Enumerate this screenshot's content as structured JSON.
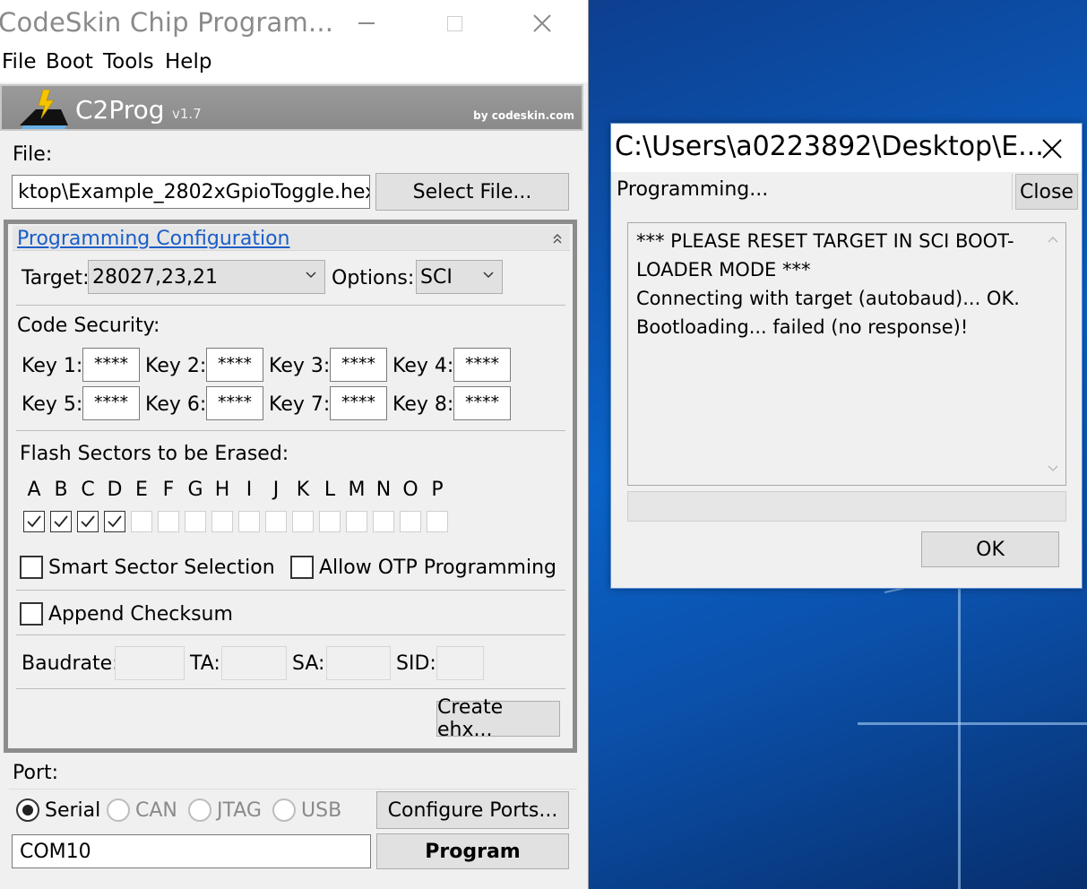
{
  "window": {
    "title": "CodeSkin Chip Program..."
  },
  "menu": [
    "File",
    "Boot",
    "Tools",
    "Help"
  ],
  "banner": {
    "title": "C2Prog",
    "version": "v1.7",
    "by": "by codeskin.com"
  },
  "file": {
    "label": "File:",
    "path": "ktop\\Example_2802xGpioToggle.hex",
    "select_button": "Select File..."
  },
  "config": {
    "title": "Programming Configuration",
    "target_label": "Target:",
    "target_value": "28027,23,21",
    "options_label": "Options:",
    "options_value": "SCI",
    "security_label": "Code Security:",
    "keys": [
      {
        "label": "Key 1:",
        "value": "****"
      },
      {
        "label": "Key 2:",
        "value": "****"
      },
      {
        "label": "Key 3:",
        "value": "****"
      },
      {
        "label": "Key 4:",
        "value": "****"
      },
      {
        "label": "Key 5:",
        "value": "****"
      },
      {
        "label": "Key 6:",
        "value": "****"
      },
      {
        "label": "Key 7:",
        "value": "****"
      },
      {
        "label": "Key 8:",
        "value": "****"
      }
    ],
    "sectors_label": "Flash Sectors to be Erased:",
    "sectors": [
      "A",
      "B",
      "C",
      "D",
      "E",
      "F",
      "G",
      "H",
      "I",
      "J",
      "K",
      "L",
      "M",
      "N",
      "O",
      "P"
    ],
    "sectors_checked": [
      true,
      true,
      true,
      true,
      false,
      false,
      false,
      false,
      false,
      false,
      false,
      false,
      false,
      false,
      false,
      false
    ],
    "smart_sector": "Smart Sector Selection",
    "allow_otp": "Allow OTP Programming",
    "append_checksum": "Append Checksum",
    "baudrate_label": "Baudrate:",
    "ta_label": "TA:",
    "sa_label": "SA:",
    "sid_label": "SID:",
    "create_ehx": "Create ehx..."
  },
  "port": {
    "label": "Port:",
    "options": [
      "Serial",
      "CAN",
      "JTAG",
      "USB"
    ],
    "selected": "Serial",
    "configure_button": "Configure Ports...",
    "com_value": "COM10",
    "program_button": "Program"
  },
  "dialog": {
    "title": "C:\\Users\\a0223892\\Desktop\\E...",
    "status": "Programming...",
    "close_button": "Close",
    "log": [
      "*** PLEASE RESET TARGET IN SCI BOOT-",
      "LOADER MODE ***",
      "Connecting with target (autobaud)...  OK.",
      "Bootloading...  failed (no response)!"
    ],
    "ok_button": "OK"
  },
  "colors": {
    "accent_link": "#1a5ec8",
    "banner_gray": "#8a8a8a",
    "desktop_blue": "#0a63c9"
  }
}
